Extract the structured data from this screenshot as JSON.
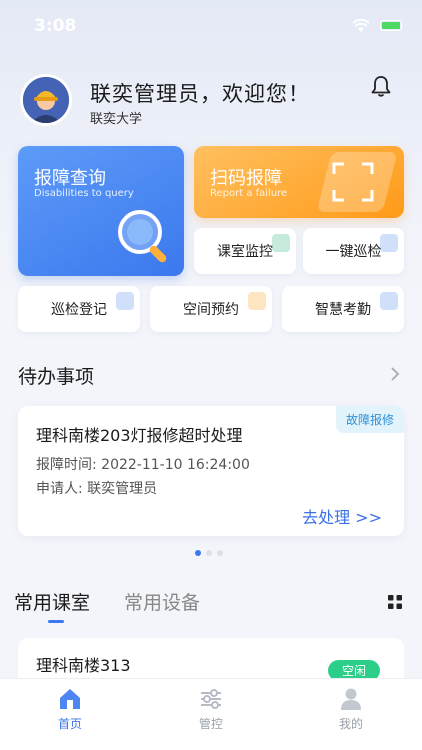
{
  "status_bar": {
    "time": "3:08"
  },
  "header": {
    "greeting": "联奕管理员，欢迎您！",
    "org": "联奕大学"
  },
  "quick_actions": {
    "report_query": {
      "title": "报障查询",
      "subtitle": "Disabilities to query"
    },
    "scan_report": {
      "title": "扫码报障",
      "subtitle": "Report a failure"
    },
    "classroom_monitor": "课室监控",
    "one_click_patrol": "一键巡检",
    "patrol_register": "巡检登记",
    "space_booking": "空间预约",
    "smart_attendance": "智慧考勤"
  },
  "todo": {
    "section_title": "待办事项",
    "items": [
      {
        "title": "理科南楼203灯报修超时处理",
        "tag": "故障报修",
        "time_line": "报障时间: 2022-11-10 16:24:00",
        "applicant_line": "申请人: 联奕管理员",
        "action": "去处理 >>"
      }
    ]
  },
  "tabs": {
    "classrooms": "常用课室",
    "devices": "常用设备"
  },
  "classrooms": [
    {
      "name": "理科南楼313",
      "status": "空闲"
    }
  ],
  "tabbar": [
    {
      "label": "首页",
      "icon": "home-icon",
      "active": true
    },
    {
      "label": "管控",
      "icon": "sliders-icon",
      "active": false
    },
    {
      "label": "我的",
      "icon": "user-icon",
      "active": false
    }
  ],
  "colors": {
    "accent": "#3b78ee",
    "report_card": "#4a88f3",
    "scan_card": "#ffa62e",
    "status_free": "#2ccf8a"
  }
}
